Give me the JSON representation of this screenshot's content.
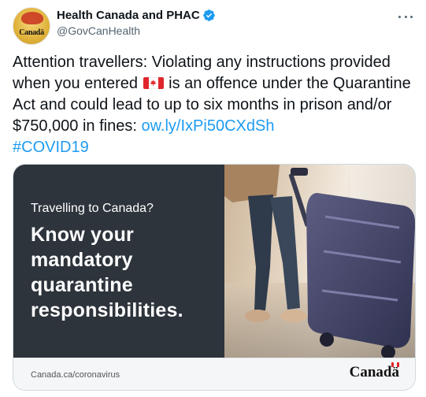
{
  "author": {
    "display_name": "Health Canada and PHAC",
    "handle": "@GovCanHealth",
    "avatar_wordmark": "Canadä"
  },
  "tweet": {
    "text_part1": "Attention travellers: Violating any instructions provided when you entered ",
    "flag_emoji": "canada-flag",
    "text_part2": " is an offence under the Quarantine Act and could lead to up to six months in prison and/or $750,000 in fines: ",
    "link": "ow.ly/IxPi50CXdSh",
    "hashtag": "#COVID19"
  },
  "card": {
    "subtitle": "Travelling to Canada?",
    "headline_lines": [
      "Know your",
      "mandatory",
      "quarantine",
      "responsibilities."
    ],
    "url": "Canada.ca/coronavirus",
    "wordmark": "Canadä"
  },
  "colors": {
    "link": "#1d9bf0",
    "verified": "#1d9bf0",
    "card_panel": "#2d343b",
    "text": "#0f1419",
    "muted": "#536471"
  },
  "icons": [
    "verified-badge-icon",
    "more-options-icon",
    "canada-flag-icon"
  ]
}
